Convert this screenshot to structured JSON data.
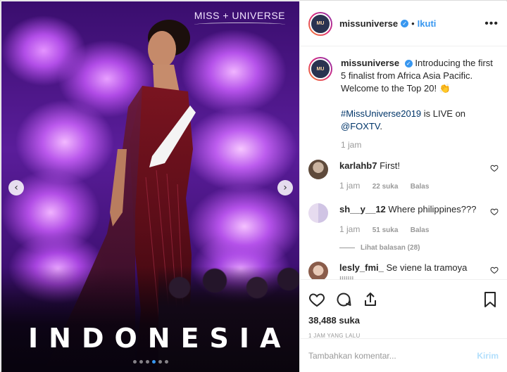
{
  "photo": {
    "brand_logo": "MISS + UNIVERSE",
    "caption_overlay": "INDONESIA",
    "prev_arrow": "‹",
    "next_arrow": "›",
    "dots_count": 6,
    "active_dot": 3
  },
  "post": {
    "username": "missuniverse",
    "avatar_text": "MU",
    "follow_label": "Ikuti",
    "separator": "•",
    "more_label": "•••",
    "caption": {
      "username": "missuniverse",
      "line1": "Introducing the first 5 finalist from Africa Asia Pacific. Welcome to the Top 20! 👏",
      "hashtag": "#MissUniverse2019",
      "line2": " is LIVE on",
      "mention": "@FOXTV",
      "line2_end": ".",
      "time": "1 jam"
    },
    "comments": [
      {
        "username": "karlahb7",
        "text": "First!",
        "time": "1 jam",
        "likes": "22 suka",
        "reply": "Balas"
      },
      {
        "username": "sh__y__12",
        "text": "Where philippines???",
        "time": "1 jam",
        "likes": "51 suka",
        "reply": "Balas",
        "view_replies": "Lihat balasan (28)"
      },
      {
        "username": "lesly_fmi_",
        "text": "Se viene la tramoya jjjjiji"
      }
    ],
    "likes_count": "38,488 suka",
    "timestamp": "1 JAM YANG LALU",
    "comment_placeholder": "Tambahkan komentar...",
    "send_label": "Kirim"
  },
  "colors": {
    "accent": "#3897f0",
    "send_disabled": "#b2dffc",
    "muted": "#999999",
    "text": "#262626"
  },
  "icons": [
    "heart-icon",
    "comment-icon",
    "share-icon",
    "bookmark-icon",
    "verified-icon",
    "more-icon"
  ]
}
